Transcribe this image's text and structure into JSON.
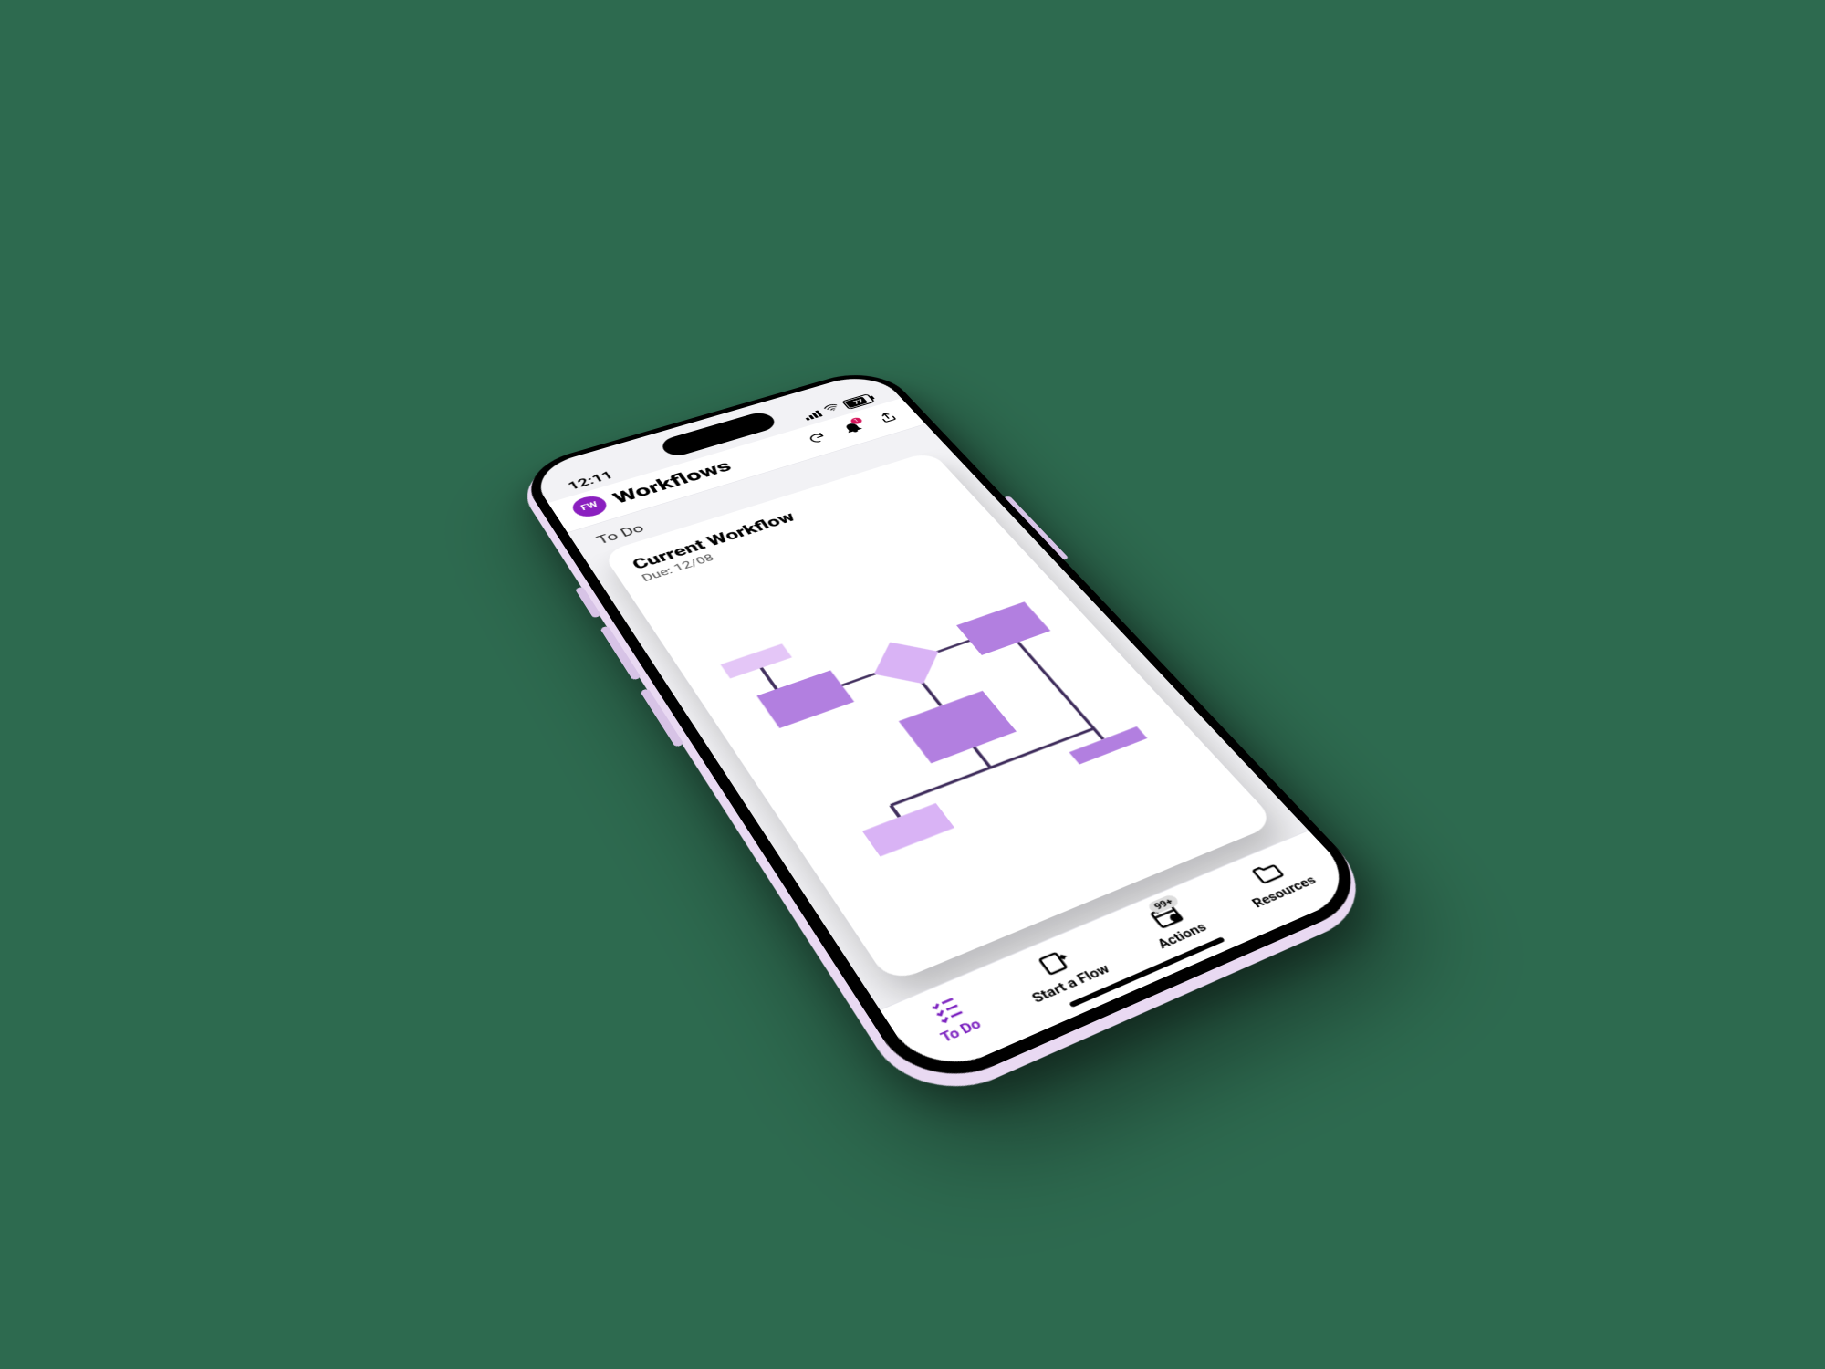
{
  "status": {
    "time": "12:11",
    "battery": "77"
  },
  "header": {
    "avatar_initials": "FW",
    "title": "Workflows",
    "notification_count": "1"
  },
  "section": {
    "label": "To Do"
  },
  "card": {
    "title": "Current Workflow",
    "subtitle": "Due: 12/08"
  },
  "tabs": {
    "todo": "To Do",
    "start": "Start a Flow",
    "actions": "Actions",
    "actions_badge": "99+",
    "resources": "Resources"
  },
  "colors": {
    "accent": "#8a1fbf",
    "background": "#2d6a4f"
  }
}
